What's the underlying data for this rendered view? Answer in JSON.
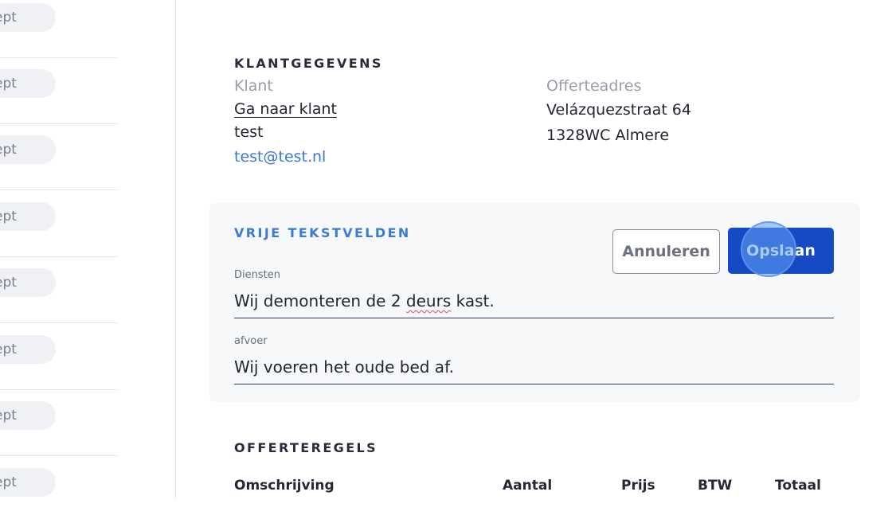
{
  "sidebar": {
    "items": [
      {
        "status": "ept"
      },
      {
        "status": "ept"
      },
      {
        "status": "ept"
      },
      {
        "status": "ept"
      },
      {
        "status": "ept"
      },
      {
        "status": "ept"
      },
      {
        "status": "ept"
      },
      {
        "status": "ept"
      }
    ]
  },
  "customer": {
    "section_title": "KLANTGEGEVENS",
    "klant_label": "Klant",
    "goto_link": "Ga naar klant",
    "name": "test",
    "email": "test@test.nl",
    "address_label": "Offerteadres",
    "street": "Velázquezstraat 64",
    "postcode_city": "1328WC Almere"
  },
  "free_text": {
    "title": "VRIJE TEKSTVELDEN",
    "cancel_label": "Annuleren",
    "save_label": "Opslaan",
    "fields": [
      {
        "label": "Diensten",
        "value_before": "Wij demonteren de 2 ",
        "value_misspelled": "deurs",
        "value_after": " kast."
      },
      {
        "label": "afvoer",
        "value": "Wij voeren het oude bed af."
      }
    ]
  },
  "lines": {
    "section_title": "OFFERTEREGELS",
    "columns": [
      "Omschrijving",
      "Aantal",
      "Prijs",
      "BTW",
      "Totaal"
    ]
  }
}
